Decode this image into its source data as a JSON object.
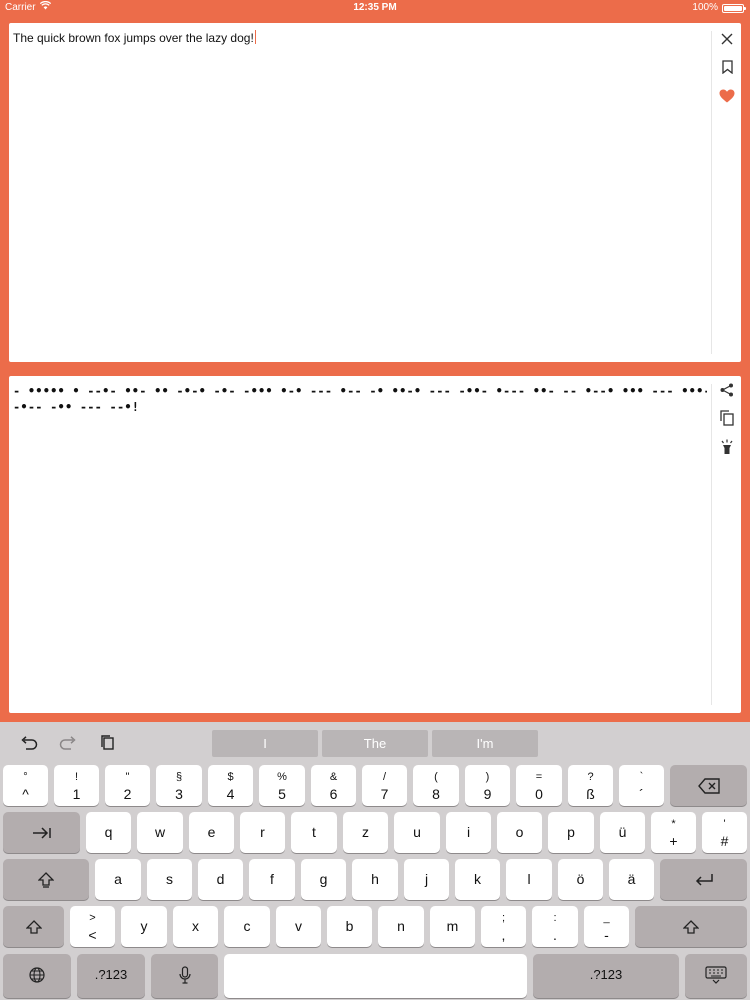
{
  "status_bar": {
    "carrier": "Carrier",
    "time": "12:35 PM",
    "battery": "100%"
  },
  "input_panel": {
    "text": "The quick brown fox jumps over the lazy dog!",
    "icons": [
      "close-icon",
      "bookmark-icon",
      "heart-icon"
    ],
    "accent": "#ec6c4a"
  },
  "output_panel": {
    "morse_line1": "- ••••• •  --•- ••- •• -•-• -•-  -••• •-• --- •-- -•  ••-• --- -••-  •--- ••- -- •--• •••  --- •••- • •-•  - •••• •  •-•• •- --••",
    "morse_line2": "-•--  -•• --- --•!",
    "icons": [
      "share-icon",
      "copy-icon",
      "flashlight-icon"
    ]
  },
  "keyboard": {
    "tools": [
      "undo-icon",
      "redo-icon",
      "paste-icon"
    ],
    "suggestions": [
      "I",
      "The",
      "I'm"
    ],
    "row1": [
      {
        "top": "°",
        "bottom": "^"
      },
      {
        "top": "!",
        "bottom": "1"
      },
      {
        "top": "\"",
        "bottom": "2"
      },
      {
        "top": "§",
        "bottom": "3"
      },
      {
        "top": "$",
        "bottom": "4"
      },
      {
        "top": "%",
        "bottom": "5"
      },
      {
        "top": "&",
        "bottom": "6"
      },
      {
        "top": "/",
        "bottom": "7"
      },
      {
        "top": "(",
        "bottom": "8"
      },
      {
        "top": ")",
        "bottom": "9"
      },
      {
        "top": "=",
        "bottom": "0"
      },
      {
        "top": "?",
        "bottom": "ß"
      },
      {
        "top": "`",
        "bottom": "´"
      }
    ],
    "row2": [
      "q",
      "w",
      "e",
      "r",
      "t",
      "z",
      "u",
      "i",
      "o",
      "p",
      "ü"
    ],
    "row2_extra": [
      {
        "top": "*",
        "bottom": "+"
      },
      {
        "top": "'",
        "bottom": "#"
      }
    ],
    "row3": [
      "a",
      "s",
      "d",
      "f",
      "g",
      "h",
      "j",
      "k",
      "l",
      "ö",
      "ä"
    ],
    "row4": [
      "y",
      "x",
      "c",
      "v",
      "b",
      "n",
      "m"
    ],
    "row4_left": {
      "top": ">",
      "bottom": "<"
    },
    "row4_extra": [
      {
        "top": ";",
        "bottom": ","
      },
      {
        "top": ":",
        "bottom": "."
      },
      {
        "top": "_",
        "bottom": "-"
      }
    ],
    "numbers_label": ".?123"
  }
}
